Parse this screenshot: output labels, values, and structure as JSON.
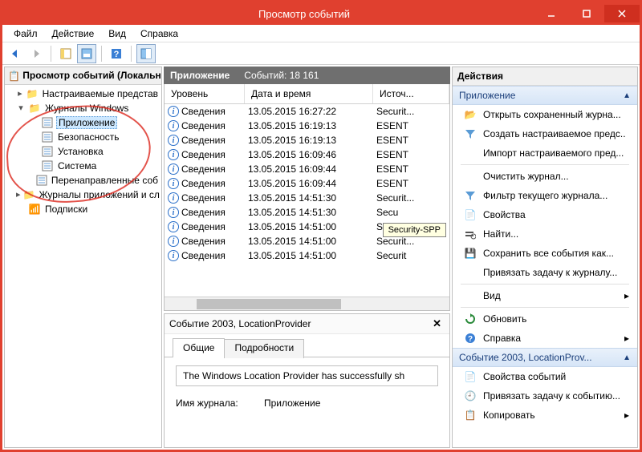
{
  "window": {
    "title": "Просмотр событий",
    "tooltip": "Security-SPP"
  },
  "menubar": [
    "Файл",
    "Действие",
    "Вид",
    "Справка"
  ],
  "tree": {
    "header": "Просмотр событий (Локальны",
    "root_settings": "Настраиваемые представ",
    "windows_logs": "Журналы Windows",
    "items": [
      "Приложение",
      "Безопасность",
      "Установка",
      "Система",
      "Перенаправленные соб"
    ],
    "apps_logs": "Журналы приложений и сл",
    "subs": "Подписки"
  },
  "grid": {
    "title": "Приложение",
    "count_label": "Событий: 18 161",
    "columns": [
      "Уровень",
      "Дата и время",
      "Источ..."
    ],
    "level_text": "Сведения",
    "rows": [
      {
        "dt": "13.05.2015 16:27:22",
        "src": "Securit..."
      },
      {
        "dt": "13.05.2015 16:19:13",
        "src": "ESENT"
      },
      {
        "dt": "13.05.2015 16:19:13",
        "src": "ESENT"
      },
      {
        "dt": "13.05.2015 16:09:46",
        "src": "ESENT"
      },
      {
        "dt": "13.05.2015 16:09:44",
        "src": "ESENT"
      },
      {
        "dt": "13.05.2015 16:09:44",
        "src": "ESENT"
      },
      {
        "dt": "13.05.2015 14:51:30",
        "src": "Securit..."
      },
      {
        "dt": "13.05.2015 14:51:30",
        "src": "Secu"
      },
      {
        "dt": "13.05.2015 14:51:00",
        "src": "Secu"
      },
      {
        "dt": "13.05.2015 14:51:00",
        "src": "Securit..."
      },
      {
        "dt": "13.05.2015 14:51:00",
        "src": "Securit"
      }
    ]
  },
  "details": {
    "header": "Событие 2003, LocationProvider",
    "tabs": [
      "Общие",
      "Подробности"
    ],
    "message": "The Windows Location Provider has successfully sh",
    "log_label": "Имя журнала:",
    "log_value": "Приложение"
  },
  "actions": {
    "title": "Действия",
    "section1": "Приложение",
    "section2": "Событие 2003, LocationProv...",
    "primary": [
      "Открыть сохраненный журна...",
      "Создать настраиваемое предс..",
      "Импорт настраиваемого пред...",
      "Очистить журнал...",
      "Фильтр текущего журнала...",
      "Свойства",
      "Найти...",
      "Сохранить все события как...",
      "Привязать задачу к журналу...",
      "Вид",
      "Обновить",
      "Справка"
    ],
    "secondary": [
      "Свойства событий",
      "Привязать задачу к событию...",
      "Копировать"
    ]
  }
}
